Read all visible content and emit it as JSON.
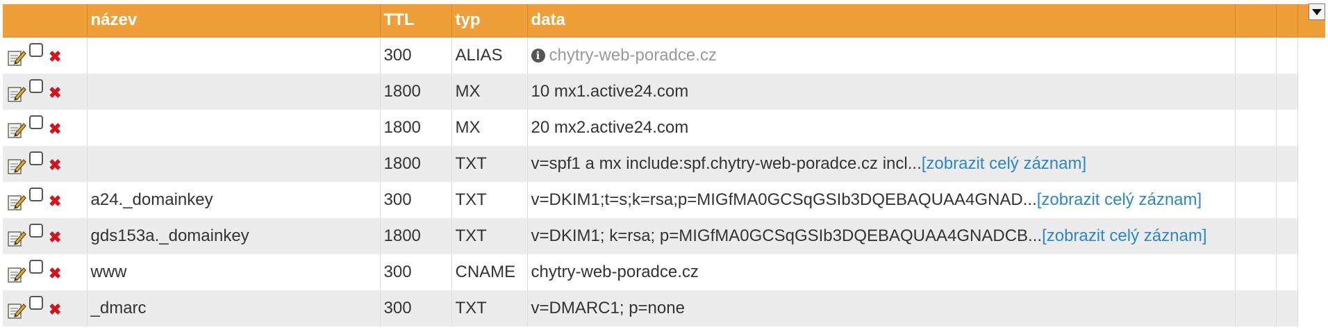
{
  "headers": {
    "name": "název",
    "ttl": "TTL",
    "type": "typ",
    "data": "data"
  },
  "columns_menu_icon": "chevron-down-icon",
  "row_icons": {
    "edit": "edit-pencil-icon",
    "delete": "delete-x-icon",
    "info": "info-icon"
  },
  "colors": {
    "header_bg": "#ef9f3a",
    "row_alt_bg": "#ececec",
    "link": "#2b86cf",
    "delete": "#d4141c"
  },
  "rows": [
    {
      "name": "",
      "ttl": "300",
      "type": "ALIAS",
      "data": "chytry-web-poradce.cz",
      "more": ""
    },
    {
      "name": "",
      "ttl": "1800",
      "type": "MX",
      "data": "10 mx1.active24.com",
      "more": ""
    },
    {
      "name": "",
      "ttl": "1800",
      "type": "MX",
      "data": "20 mx2.active24.com",
      "more": ""
    },
    {
      "name": "",
      "ttl": "1800",
      "type": "TXT",
      "data": "v=spf1 a mx include:spf.chytry-web-poradce.cz incl...",
      "more": "[zobrazit celý záznam]"
    },
    {
      "name": "a24._domainkey",
      "ttl": "300",
      "type": "TXT",
      "data": "v=DKIM1;t=s;k=rsa;p=MIGfMA0GCSqGSIb3DQEBAQUAA4GNAD...",
      "more": "[zobrazit celý záznam]"
    },
    {
      "name": "gds153a._domainkey",
      "ttl": "1800",
      "type": "TXT",
      "data": "v=DKIM1; k=rsa; p=MIGfMA0GCSqGSIb3DQEBAQUAA4GNADCB...",
      "more": "[zobrazit celý záznam]"
    },
    {
      "name": "www",
      "ttl": "300",
      "type": "CNAME",
      "data": "chytry-web-poradce.cz",
      "more": ""
    },
    {
      "name": "_dmarc",
      "ttl": "300",
      "type": "TXT",
      "data": "v=DMARC1; p=none",
      "more": ""
    }
  ]
}
